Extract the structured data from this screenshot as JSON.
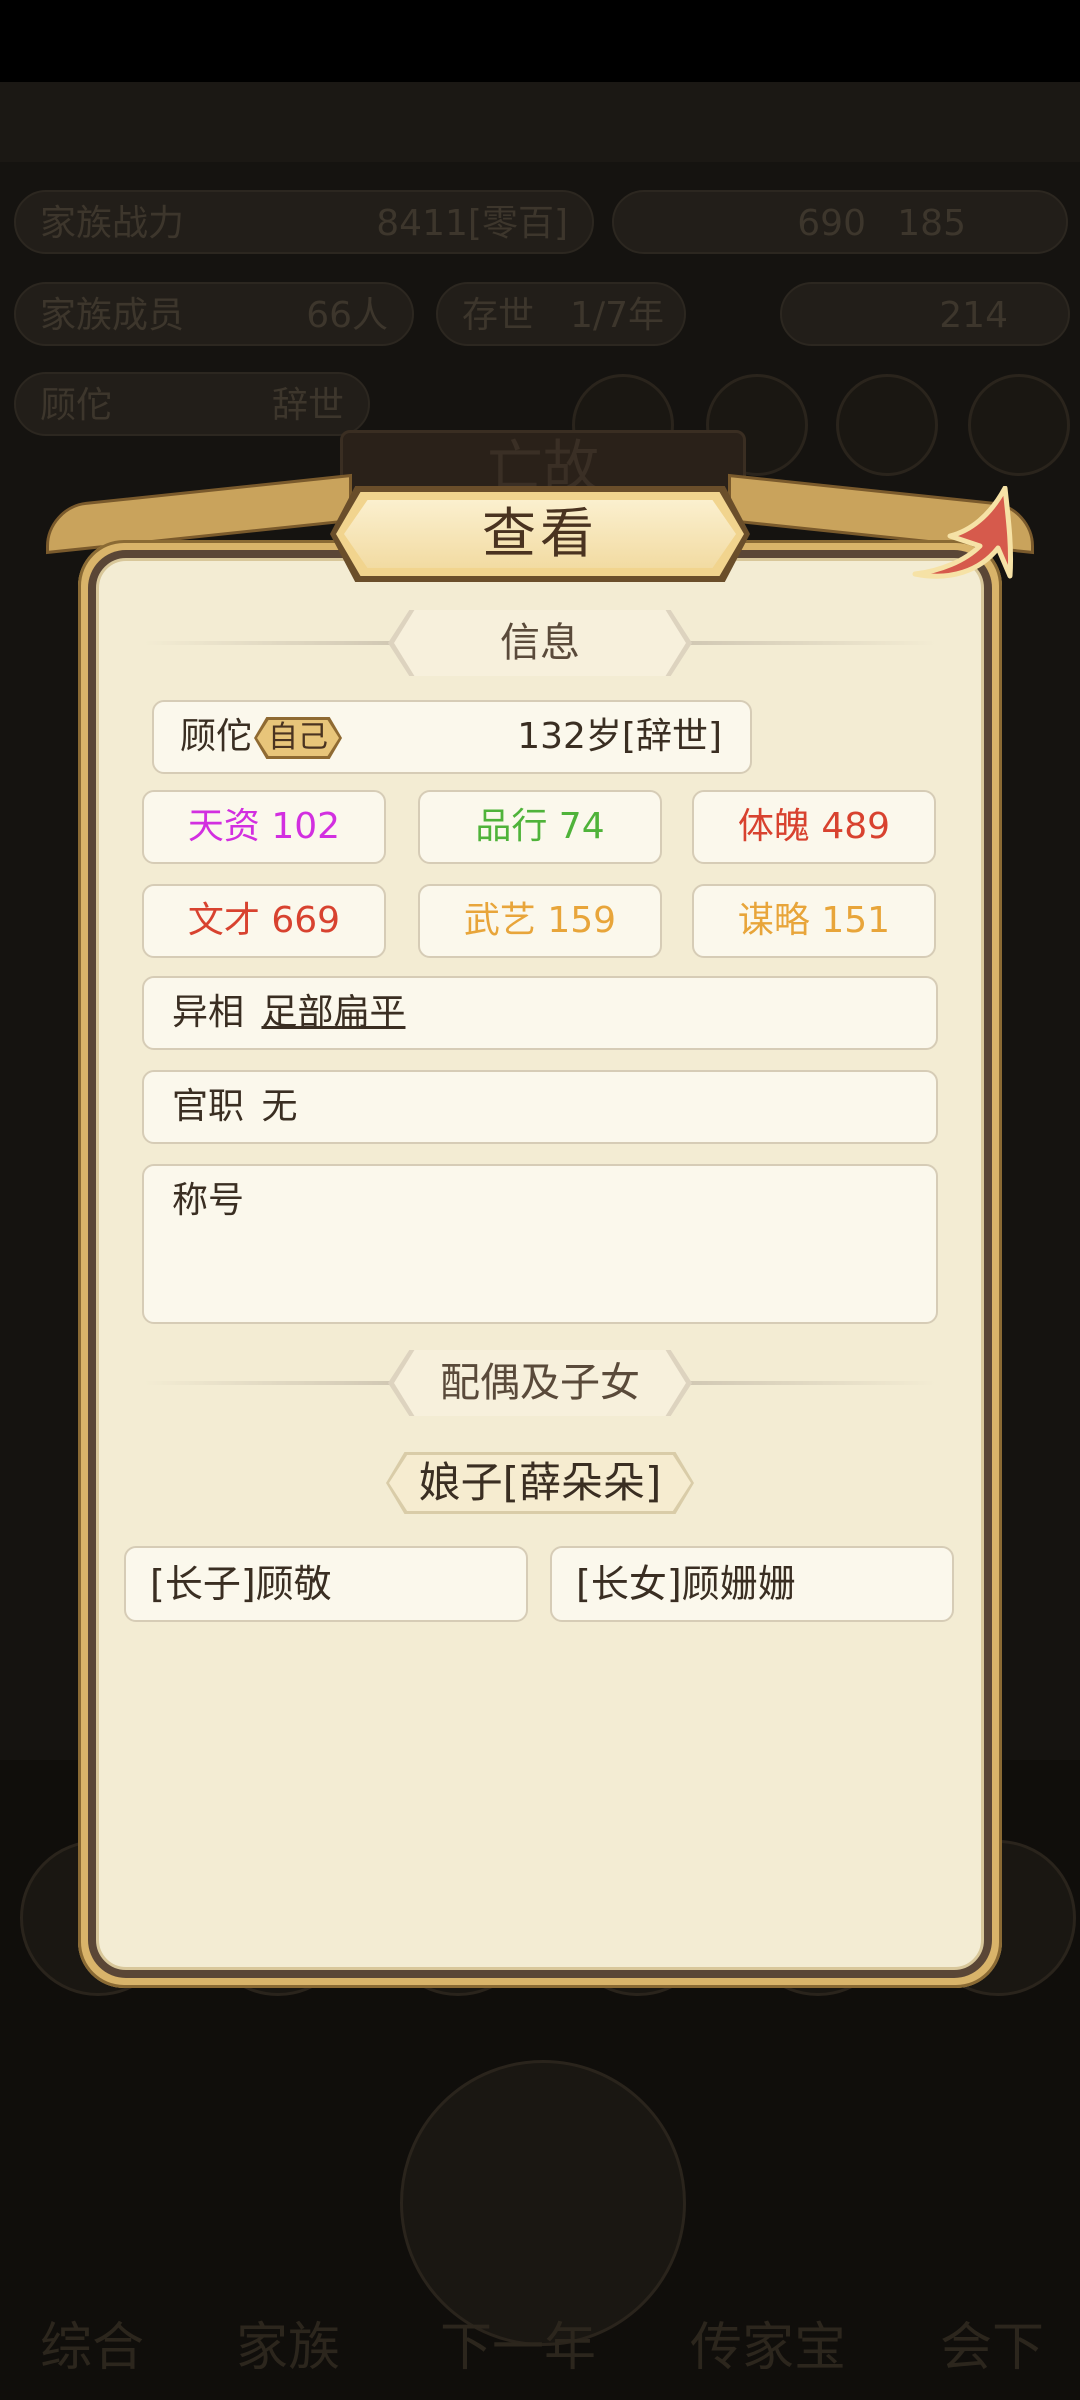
{
  "background": {
    "pills": [
      "家族战力",
      "8411[零百]",
      "690",
      "185",
      "家族成员",
      "66人",
      "存世",
      "1/7年",
      "214",
      "顾佗",
      "辞世"
    ],
    "overlay_title": "亡故",
    "nav": [
      "综合",
      "家族",
      "下一年",
      "传家宝",
      "会下"
    ]
  },
  "dialog": {
    "title": "查看",
    "info_header": "信息",
    "person": {
      "name": "顾佗",
      "self_tag": "自己",
      "age_status": "132岁[辞世]"
    },
    "stats": [
      {
        "label": "天资 102",
        "color": "#d22fe0"
      },
      {
        "label": "品行 74",
        "color": "#4fb33a"
      },
      {
        "label": "体魄 489",
        "color": "#d8422f"
      },
      {
        "label": "文才 669",
        "color": "#d8422f"
      },
      {
        "label": "武艺 159",
        "color": "#e8a53a"
      },
      {
        "label": "谋略 151",
        "color": "#e8a53a"
      }
    ],
    "trait_label": "异相",
    "trait_value": "足部扁平",
    "office_label": "官职",
    "office_value": "无",
    "honor_label": "称号",
    "family_header": "配偶及子女",
    "spouse": "娘子[薛朵朵]",
    "children": [
      "[长子]顾敬",
      "[长女]顾姗姗"
    ]
  }
}
